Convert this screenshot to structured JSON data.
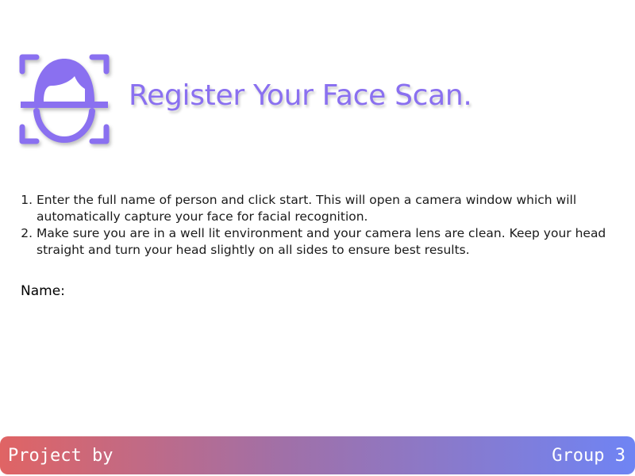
{
  "header": {
    "title": "Register Your Face Scan.",
    "icon": "face-scan-icon",
    "accent_color": "#8a70f0"
  },
  "instructions": [
    "Enter the full name of person and click start. This will open a camera window which will automatically capture your face for facial recognition.",
    "Make sure you are in a well lit environment and your camera lens are clean. Keep your head straight and turn your head slightly on all sides to ensure best results."
  ],
  "form": {
    "name_label": "Name:",
    "name_value": ""
  },
  "footer": {
    "left_text": "Project by",
    "right_text": "Group 3",
    "gradient_colors": [
      "#e06464",
      "#6f84f4"
    ]
  }
}
